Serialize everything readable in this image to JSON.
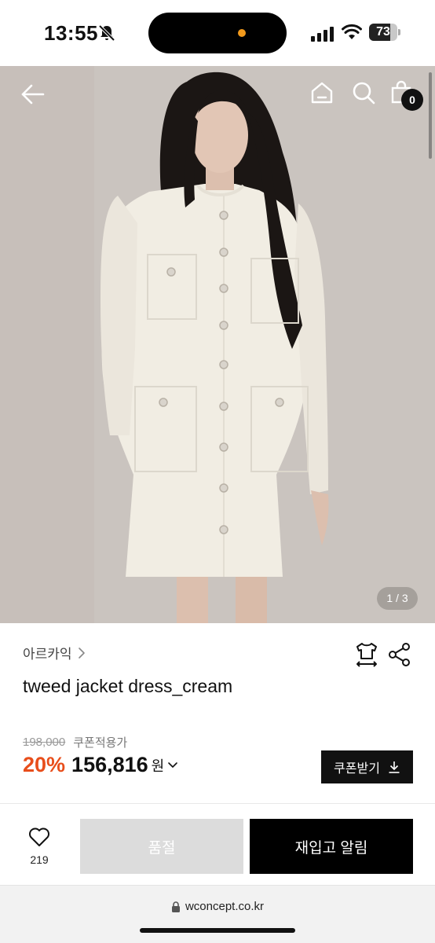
{
  "status_bar": {
    "time": "13:55",
    "battery_level": "73",
    "icons": [
      "bell-slash-icon",
      "signal-icon",
      "wifi-icon",
      "battery-icon"
    ]
  },
  "hero": {
    "image_counter": "1 / 3",
    "cart_count": "0",
    "icons": [
      "back-arrow-icon",
      "home-icon",
      "search-icon",
      "shopping-bag-icon"
    ]
  },
  "product": {
    "brand": "아르카익",
    "title": "tweed jacket dress_cream",
    "original_price": "198,000",
    "coupon_price_label": "쿠폰적용가",
    "discount": "20%",
    "sale_price": "156,816",
    "currency": "원",
    "coupon_button": "쿠폰받기"
  },
  "actions": {
    "like_count": "219",
    "soldout_label": "품절",
    "restock_label": "재입고 알림"
  },
  "browser": {
    "url": "wconcept.co.kr"
  },
  "colors": {
    "discount": "#e84e1b",
    "primary_button": "#000000",
    "disabled_button": "#dcdcdc"
  }
}
